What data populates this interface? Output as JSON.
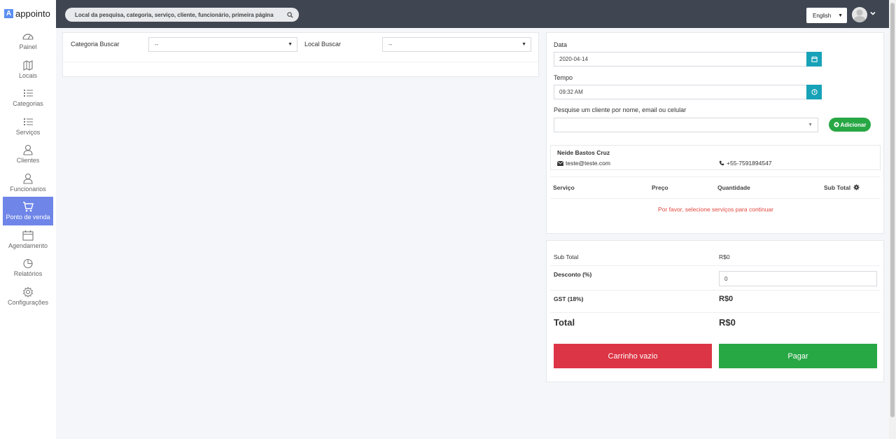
{
  "app": {
    "logo_letter": "A",
    "logo_text": "appointo"
  },
  "topbar": {
    "search_placeholder": "Local da pesquisa, categoria, serviço, cliente, funcionário, primeira página",
    "language": "English"
  },
  "sidebar": {
    "items": [
      {
        "label": "Painel",
        "icon": "dashboard-icon"
      },
      {
        "label": "Locais",
        "icon": "map-icon"
      },
      {
        "label": "Categorias",
        "icon": "list-icon"
      },
      {
        "label": "Serviços",
        "icon": "list-icon"
      },
      {
        "label": "Clientes",
        "icon": "user-icon"
      },
      {
        "label": "Funcionarios",
        "icon": "user-icon"
      },
      {
        "label": "Ponto de venda",
        "icon": "cart-icon",
        "active": true
      },
      {
        "label": "Agendamento",
        "icon": "calendar-icon"
      },
      {
        "label": "Relatórios",
        "icon": "pie-chart-icon"
      },
      {
        "label": "Configurações",
        "icon": "gear-icon"
      }
    ]
  },
  "filters": {
    "category_label": "Categoria Buscar",
    "category_value": "--",
    "location_label": "Local Buscar",
    "location_value": "--"
  },
  "booking": {
    "date_label": "Data",
    "date_value": "2020-04-14",
    "time_label": "Tempo",
    "time_value": "09:32 AM",
    "customer_search_label": "Pesquise um cliente por nome, email ou celular",
    "add_button": "Adicionar",
    "client": {
      "name": "Neide Bastos Cruz",
      "email": "teste@teste.com",
      "phone": "+55-7591894547"
    },
    "table_headers": {
      "service": "Serviço",
      "price": "Preço",
      "quantity": "Quantidade",
      "subtotal": "Sub Total"
    },
    "empty_message": "Por favor, selecione serviços para continuar"
  },
  "summary": {
    "subtotal_label": "Sub Total",
    "subtotal_value": "R$0",
    "discount_label": "Desconto (%)",
    "discount_value": "0",
    "gst_label": "GST (18%)",
    "gst_value": "R$0",
    "total_label": "Total",
    "total_value": "R$0",
    "empty_cart_button": "Carrinho vazio",
    "pay_button": "Pagar"
  },
  "colors": {
    "topbar": "#3f4551",
    "active_nav": "#6f86e8",
    "teal": "#17a2b8",
    "green": "#28a745",
    "red": "#dc3545",
    "message_red": "#e0473d"
  }
}
